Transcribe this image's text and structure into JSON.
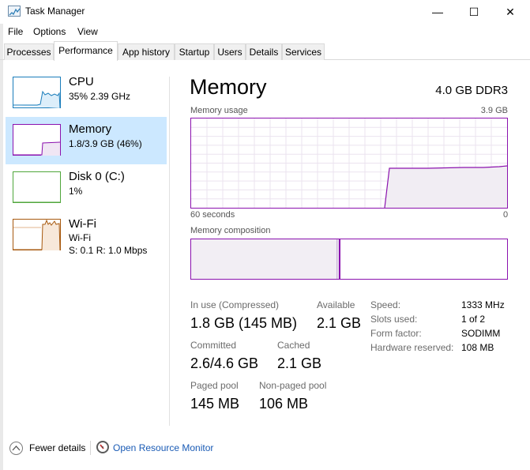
{
  "window": {
    "title": "Task Manager",
    "minimize": "—",
    "maximize": "☐",
    "close": "✕"
  },
  "menu": [
    "File",
    "Options",
    "View"
  ],
  "tabs": [
    "Processes",
    "Performance",
    "App history",
    "Startup",
    "Users",
    "Details",
    "Services"
  ],
  "sidebar": [
    {
      "title": "CPU",
      "sub1": "35%  2.39 GHz",
      "sub2": ""
    },
    {
      "title": "Memory",
      "sub1": "1.8/3.9 GB (46%)",
      "sub2": ""
    },
    {
      "title": "Disk 0 (C:)",
      "sub1": "1%",
      "sub2": ""
    },
    {
      "title": "Wi-Fi",
      "sub1": "Wi-Fi",
      "sub2": "S: 0.1  R: 1.0 Mbps"
    }
  ],
  "main": {
    "title": "Memory",
    "spec": "4.0 GB DDR3",
    "usage_label": "Memory usage",
    "usage_max": "3.9 GB",
    "time_left": "60 seconds",
    "time_right": "0",
    "composition_label": "Memory composition"
  },
  "stats": {
    "in_use_label": "In use (Compressed)",
    "in_use_value": "1.8 GB (145 MB)",
    "available_label": "Available",
    "available_value": "2.1 GB",
    "committed_label": "Committed",
    "committed_value": "2.6/4.6 GB",
    "cached_label": "Cached",
    "cached_value": "2.1 GB",
    "paged_label": "Paged pool",
    "paged_value": "145 MB",
    "nonpaged_label": "Non-paged pool",
    "nonpaged_value": "106 MB"
  },
  "hw": [
    {
      "label": "Speed:",
      "value": "1333 MHz"
    },
    {
      "label": "Slots used:",
      "value": "1 of 2"
    },
    {
      "label": "Form factor:",
      "value": "SODIMM"
    },
    {
      "label": "Hardware reserved:",
      "value": "108 MB"
    }
  ],
  "footer": {
    "fewer": "Fewer details",
    "open_rm": "Open Resource Monitor"
  },
  "colors": {
    "memory": "#8b12ae",
    "cpu": "#1a7dbb",
    "disk": "#4fa63b",
    "wifi": "#a7590f",
    "selection": "#cce8ff",
    "link": "#1a5bb5"
  },
  "icons": [
    "task-manager-icon",
    "chevron-up-icon",
    "resource-monitor-icon"
  ]
}
